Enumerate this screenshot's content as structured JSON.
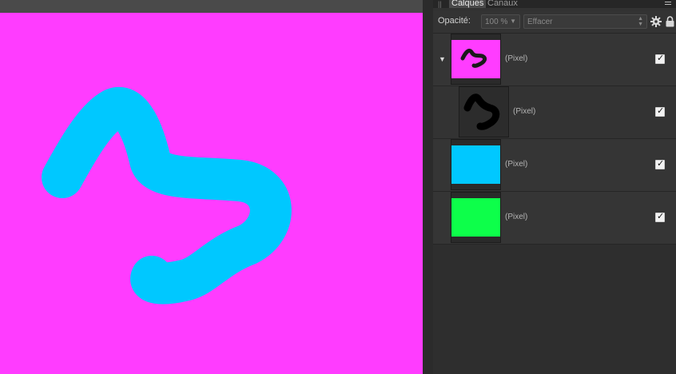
{
  "panel": {
    "tabs": [
      {
        "label": "Calques",
        "active": true
      },
      {
        "label": "Canaux",
        "active": false
      }
    ]
  },
  "opacity": {
    "label": "Opacité:",
    "value": "100 %",
    "blend_mode_placeholder": "Effacer"
  },
  "layers": [
    {
      "name": "(Pixel)",
      "thumb": "magenta-with-black-stroke",
      "expanded": true,
      "visible": true
    },
    {
      "name": "(Pixel)",
      "thumb": "black-stroke-mask",
      "child": true,
      "visible": true
    },
    {
      "name": "(Pixel)",
      "thumb": "cyan-fill",
      "visible": true
    },
    {
      "name": "(Pixel)",
      "thumb": "green-fill",
      "visible": true
    }
  ],
  "colors": {
    "canvas_background": "#ff3cff",
    "stroke_cyan": "#00c8ff",
    "layer_green": "#0dff4a",
    "panel_bg": "#323232"
  },
  "icons": {
    "expand": "triangle-down-icon",
    "settings": "gear-icon",
    "lock": "lock-icon",
    "visibility": "checkbox-icon"
  }
}
